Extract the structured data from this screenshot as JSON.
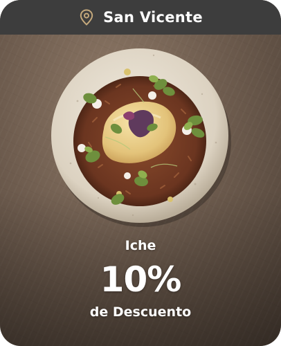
{
  "header": {
    "location": "San Vicente",
    "icon": "location-pin-icon"
  },
  "image": {
    "subject": "food-bowl-image"
  },
  "offer": {
    "name": "Iche",
    "percent": "10%",
    "subtitle": "de Descuento"
  },
  "colors": {
    "header_bg": "#3d3d3d",
    "pin": "#c5a97c",
    "text": "#ffffff"
  }
}
